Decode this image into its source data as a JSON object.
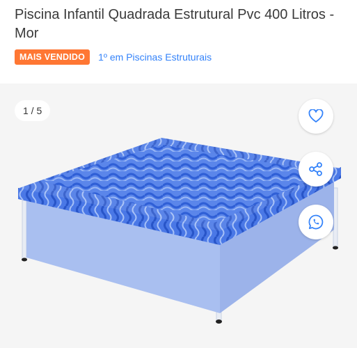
{
  "product": {
    "title": "Piscina Infantil Quadrada Estrutural Pvc 400 Litros - Mor",
    "badge": "MAIS VENDIDO",
    "ranking": "1º em Piscinas Estruturais"
  },
  "gallery": {
    "counter": "1 / 5",
    "image_subject": "blue square structural kids pool with wavy pattern",
    "actions": [
      {
        "icon": "heart-icon",
        "label": "favorite"
      },
      {
        "icon": "share-icon",
        "label": "share"
      },
      {
        "icon": "whatsapp-icon",
        "label": "whatsapp"
      }
    ]
  },
  "colors": {
    "badge_bg": "#ff7733",
    "link": "#3483fa",
    "icon": "#3483fa",
    "pool_light": "#a9bff0",
    "pool_dark": "#3e6fe0"
  }
}
